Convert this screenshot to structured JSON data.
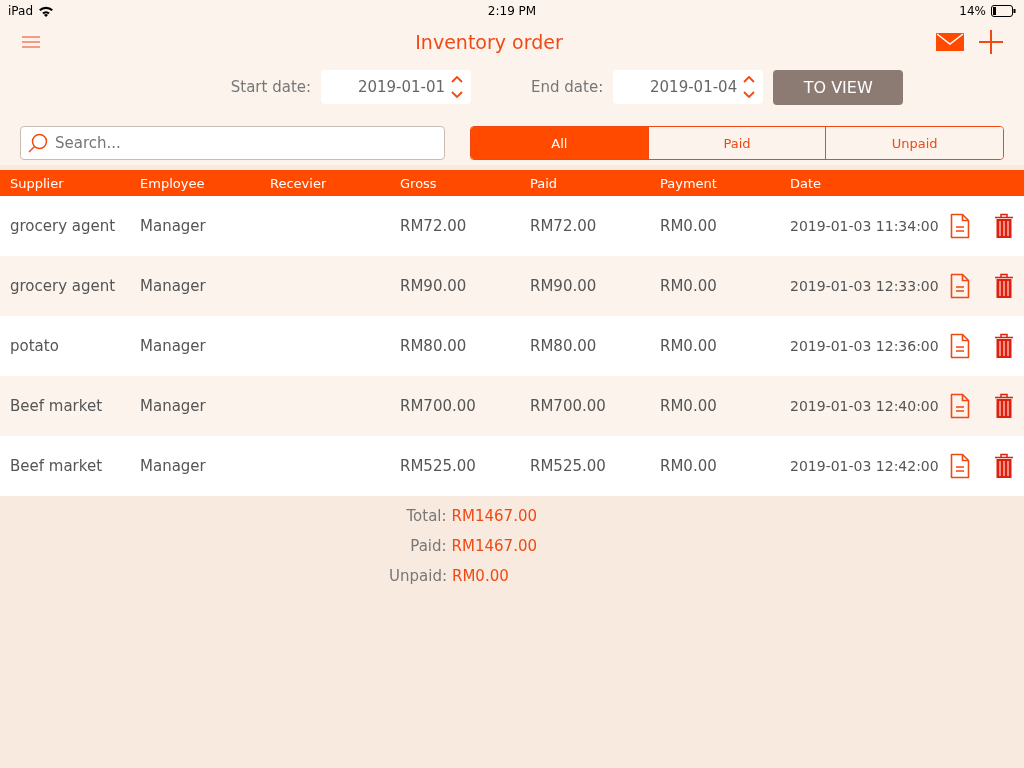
{
  "status_bar": {
    "device": "iPad",
    "time": "2:19 PM",
    "battery": "14%"
  },
  "nav": {
    "title": "Inventory order"
  },
  "filters": {
    "start_label": "Start date:",
    "start_value": "2019-01-01",
    "end_label": "End date:",
    "end_value": "2019-01-04",
    "view_button": "TO VIEW"
  },
  "search": {
    "placeholder": "Search..."
  },
  "tabs": [
    {
      "label": "All",
      "selected": true
    },
    {
      "label": "Paid",
      "selected": false
    },
    {
      "label": "Unpaid",
      "selected": false
    }
  ],
  "table": {
    "columns": [
      "Supplier",
      "Employee",
      "Recevier",
      "Gross",
      "Paid",
      "Payment",
      "Date"
    ],
    "rows": [
      {
        "cells": [
          "grocery agent",
          "Manager",
          "",
          "RM72.00",
          "RM72.00",
          "RM0.00",
          "2019-01-03 11:34:00"
        ]
      },
      {
        "cells": [
          "grocery agent",
          "Manager",
          "",
          "RM90.00",
          "RM90.00",
          "RM0.00",
          "2019-01-03 12:33:00"
        ]
      },
      {
        "cells": [
          "potato",
          "Manager",
          "",
          "RM80.00",
          "RM80.00",
          "RM0.00",
          "2019-01-03 12:36:00"
        ]
      },
      {
        "cells": [
          "Beef market",
          "Manager",
          "",
          "RM700.00",
          "RM700.00",
          "RM0.00",
          "2019-01-03 12:40:00"
        ]
      },
      {
        "cells": [
          "Beef market",
          "Manager",
          "",
          "RM525.00",
          "RM525.00",
          "RM0.00",
          "2019-01-03 12:42:00"
        ]
      }
    ]
  },
  "summary": [
    {
      "label": "Total:",
      "value": "RM1467.00"
    },
    {
      "label": "Paid:",
      "value": "RM1467.00"
    },
    {
      "label": "Unpaid:",
      "value": "RM0.00"
    }
  ]
}
